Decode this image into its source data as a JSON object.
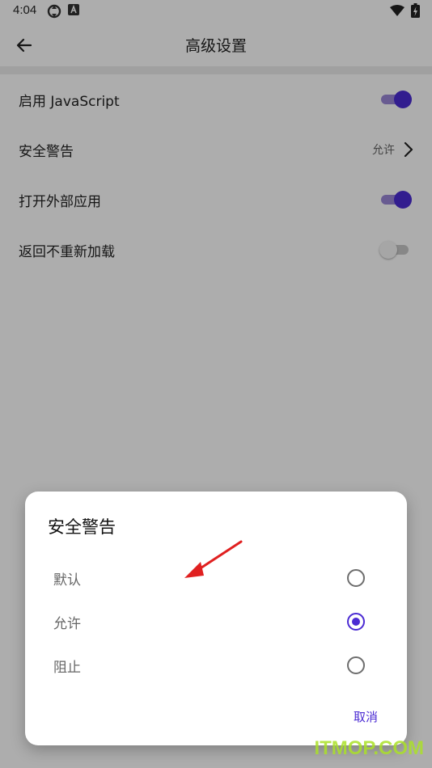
{
  "status_bar": {
    "time": "4:04"
  },
  "app_bar": {
    "title": "高级设置"
  },
  "settings": [
    {
      "label": "启用 JavaScript",
      "control": "switch",
      "on": true
    },
    {
      "label": "安全警告",
      "control": "value",
      "value": "允许"
    },
    {
      "label": "打开外部应用",
      "control": "switch",
      "on": true
    },
    {
      "label": "返回不重新加载",
      "control": "switch",
      "on": false
    }
  ],
  "dialog": {
    "title": "安全警告",
    "options": [
      {
        "label": "默认",
        "selected": false
      },
      {
        "label": "允许",
        "selected": true
      },
      {
        "label": "阻止",
        "selected": false
      }
    ],
    "cancel_label": "取消"
  },
  "colors": {
    "accent": "#4b2bd3",
    "arrow": "#e02020",
    "watermark": "#a6dd28"
  },
  "watermark": "ITMOP.COM"
}
